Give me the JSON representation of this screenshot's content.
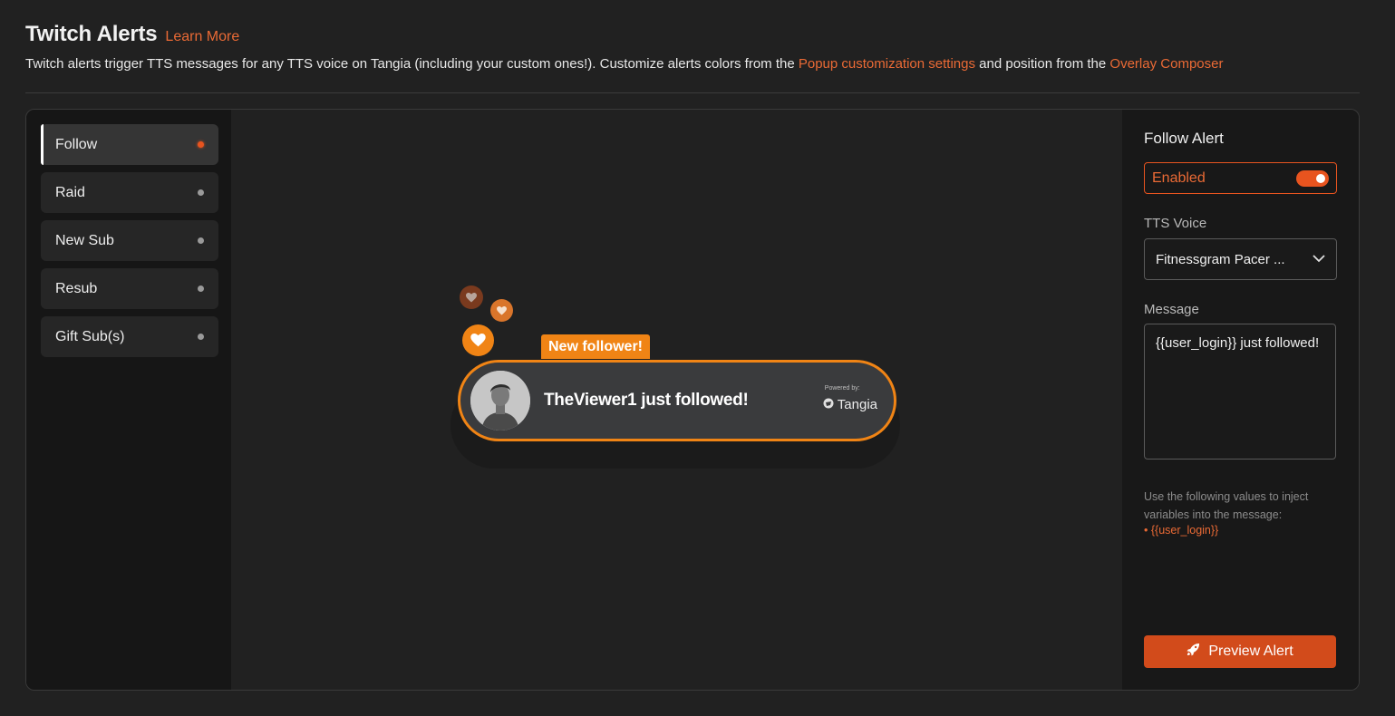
{
  "header": {
    "title": "Twitch Alerts",
    "learn_more": "Learn More",
    "desc_part1": "Twitch alerts trigger TTS messages for any TTS voice on Tangia (including your custom ones!). Customize alerts colors from the",
    "desc_link1": "Popup customization settings",
    "desc_part2": "and position from the",
    "desc_link2": "Overlay Composer"
  },
  "sidebar": {
    "items": [
      {
        "label": "Follow",
        "active": true,
        "enabled": true
      },
      {
        "label": "Raid",
        "active": false,
        "enabled": false
      },
      {
        "label": "New Sub",
        "active": false,
        "enabled": false
      },
      {
        "label": "Resub",
        "active": false,
        "enabled": false
      },
      {
        "label": "Gift Sub(s)",
        "active": false,
        "enabled": false
      }
    ]
  },
  "preview": {
    "tag": "New follower!",
    "message": "TheViewer1 just followed!",
    "powered_by": "Powered by:",
    "brand": "Tangia",
    "accent": "#f08415"
  },
  "settings": {
    "title": "Follow Alert",
    "enabled_label": "Enabled",
    "enabled": true,
    "tts_label": "TTS Voice",
    "tts_value": "Fitnessgram Pacer ...",
    "message_label": "Message",
    "message_value": "{{user_login}} just followed!",
    "hint": "Use the following values to inject variables into the message:",
    "hint_var": "• {{user_login}}",
    "preview_button": "Preview Alert",
    "accent": "#e8541f"
  }
}
